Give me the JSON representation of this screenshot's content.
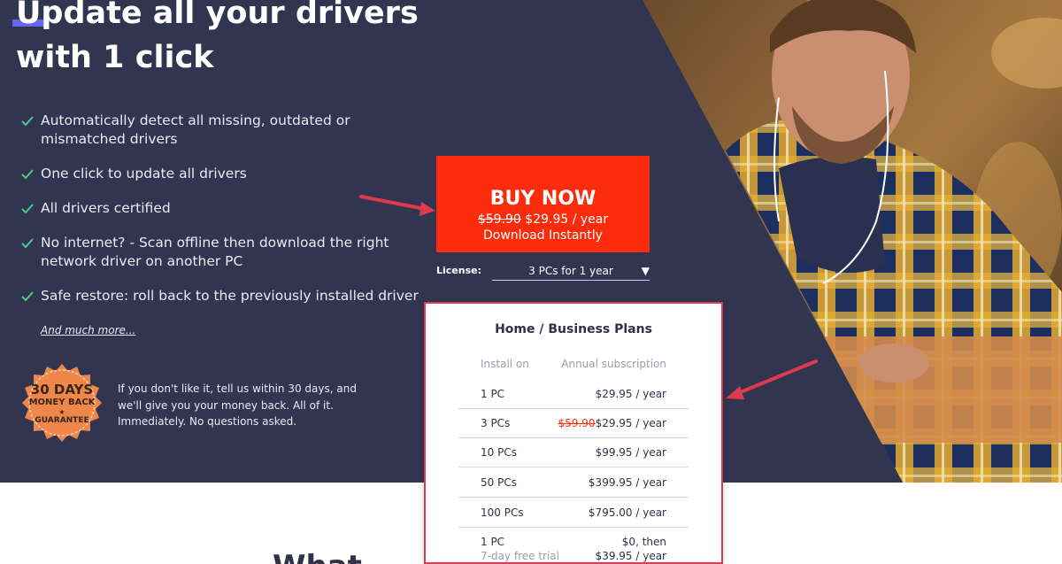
{
  "hero": {
    "headline_line1": "Update all your drivers",
    "headline_line2": "with 1 click",
    "features": [
      {
        "line1": "Automatically detect all missing, outdated or",
        "line2": "mismatched drivers"
      },
      {
        "line1": "One click to update all drivers",
        "line2": ""
      },
      {
        "line1": "All drivers certified",
        "line2": ""
      },
      {
        "line1": "No internet? - Scan offline then download the right",
        "line2": "network driver on another PC"
      },
      {
        "line1": "Safe restore: roll back to the previously installed driver",
        "line2": ""
      }
    ],
    "more_link": "And much more...",
    "check_icon": "check-icon",
    "colors": {
      "background": "#323550",
      "check": "#4fc98a",
      "accent_underline": "#6f6cff"
    }
  },
  "guarantee": {
    "badge_line1": "30 DAYS",
    "badge_line2": "MONEY BACK",
    "badge_star": "★",
    "badge_line3": "GUARANTEE",
    "badge_color": "#f0874a",
    "text": "If you don't like it, tell us within 30 days, and we'll give you your money back. All of it. Immediately. No questions asked."
  },
  "buy": {
    "title": "BUY NOW",
    "old_price": "$59.90",
    "price": "$29.95 / year",
    "subtitle": "Download Instantly",
    "color": "#fa2c0b"
  },
  "license": {
    "label": "License:",
    "selected": "3 PCs for 1 year",
    "arrow": "▼"
  },
  "plans": {
    "title": "Home / Business Plans",
    "col_install": "Install on",
    "col_annual": "Annual subscription",
    "rows": [
      {
        "install": "1 PC",
        "old_price": "",
        "price": "$29.95 / year"
      },
      {
        "install": "3 PCs",
        "old_price": "$59.90",
        "price": "$29.95 / year"
      },
      {
        "install": "10 PCs",
        "old_price": "",
        "price": "$99.95 / year"
      },
      {
        "install": "50 PCs",
        "old_price": "",
        "price": "$399.95 / year"
      },
      {
        "install": "100 PCs",
        "old_price": "",
        "price": "$795.00 / year"
      }
    ],
    "trial": {
      "install": "1 PC",
      "install_note": "7-day free trial",
      "price_line1": "$0, then",
      "price_line2": "$39.95 / year"
    },
    "border_color": "#e0394e"
  },
  "section_peek": "What"
}
